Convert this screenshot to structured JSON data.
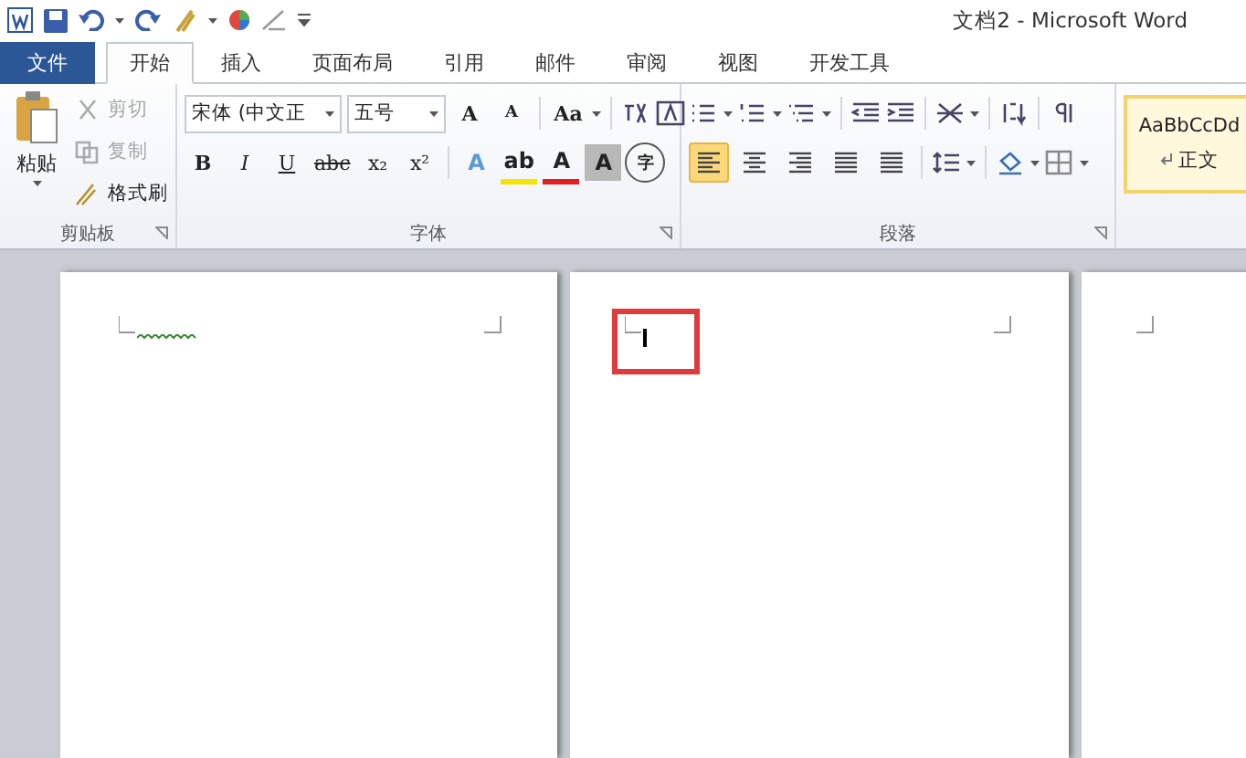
{
  "window": {
    "title": "文档2 - Microsoft Word"
  },
  "tabs": [
    {
      "label": "文件",
      "kind": "file",
      "selected": false
    },
    {
      "label": "开始",
      "kind": "tab",
      "selected": true
    },
    {
      "label": "插入",
      "kind": "tab",
      "selected": false
    },
    {
      "label": "页面布局",
      "kind": "tab",
      "selected": false
    },
    {
      "label": "引用",
      "kind": "tab",
      "selected": false
    },
    {
      "label": "邮件",
      "kind": "tab",
      "selected": false
    },
    {
      "label": "审阅",
      "kind": "tab",
      "selected": false
    },
    {
      "label": "视图",
      "kind": "tab",
      "selected": false
    },
    {
      "label": "开发工具",
      "kind": "tab",
      "selected": false
    }
  ],
  "clipboard": {
    "label": "剪贴板",
    "paste": "粘贴",
    "items": [
      {
        "label": "剪切",
        "kind": "cut",
        "disabled": true
      },
      {
        "label": "复制",
        "kind": "copy",
        "disabled": true
      },
      {
        "label": "格式刷",
        "kind": "brush",
        "disabled": false
      }
    ]
  },
  "font": {
    "label": "字体",
    "font_name": "宋体 (中文正",
    "font_size": "五号",
    "grow": "A",
    "shrink": "A",
    "case": "Aa",
    "format_buttons": [
      {
        "label": "B",
        "kind": "bold"
      },
      {
        "label": "I",
        "kind": "italic"
      },
      {
        "label": "U",
        "kind": "underline"
      },
      {
        "label": "abc",
        "kind": "strike"
      },
      {
        "label": "x₂",
        "kind": "sub"
      },
      {
        "label": "x²",
        "kind": "sup"
      }
    ],
    "color_buttons": [
      {
        "label": "A",
        "kind": "effect"
      },
      {
        "label": "ab",
        "kind": "highlight"
      },
      {
        "label": "A",
        "kind": "color"
      },
      {
        "label": "A",
        "kind": "shade"
      },
      {
        "label": "字",
        "kind": "circle"
      }
    ]
  },
  "paragraph": {
    "label": "段落",
    "alignments": [
      {
        "kind": "left",
        "selected": true
      },
      {
        "kind": "center",
        "selected": false
      },
      {
        "kind": "right",
        "selected": false
      },
      {
        "kind": "justify",
        "selected": false
      },
      {
        "kind": "distributed",
        "selected": false
      }
    ]
  },
  "styles": {
    "sample": "AaBbCcDd",
    "name": "正文",
    "selected": true
  }
}
